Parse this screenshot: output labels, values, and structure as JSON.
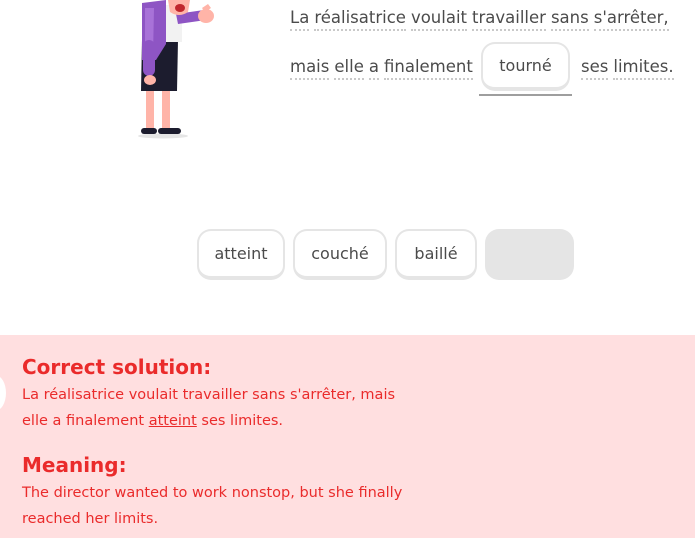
{
  "character": {
    "icon": "speaking-woman-illustration"
  },
  "sentence": {
    "line1": [
      "La",
      "réalisatrice",
      "voulait",
      "travailler",
      "sans",
      "s'arrêter,"
    ],
    "line2_before": [
      "mais",
      "elle",
      "a",
      "finalement"
    ],
    "line2_after": [
      "ses",
      "limites."
    ],
    "selected_word": "tourné"
  },
  "word_bank": [
    "atteint",
    "couché",
    "baillé"
  ],
  "feedback": {
    "solution_title": "Correct solution:",
    "solution_before": "La réalisatrice voulait travailler sans s'arrêter, mais elle a finalement ",
    "solution_answer": "atteint",
    "solution_after": " ses limites.",
    "meaning_title": "Meaning:",
    "meaning_text": "The director wanted to work nonstop, but she finally reached her limits.",
    "colors": {
      "background": "#ffdfe0",
      "text": "#ea2b2b"
    }
  }
}
